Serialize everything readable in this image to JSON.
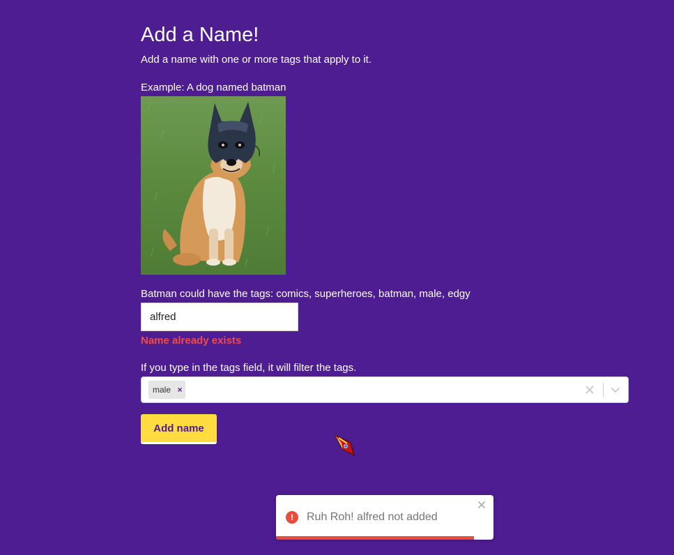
{
  "header": {
    "title": "Add a Name!",
    "subtitle": "Add a name with one or more tags that apply to it."
  },
  "example": {
    "label": "Example: A dog named batman",
    "tags_hint": "Batman could have the tags: comics, superheroes, batman, male, edgy"
  },
  "name_field": {
    "value": "alfred",
    "error": "Name already exists"
  },
  "tags_field": {
    "hint": "If you type in the tags field, it will filter the tags.",
    "selected": [
      "male"
    ],
    "remove_glyph": "×"
  },
  "submit": {
    "label": "Add name"
  },
  "toast": {
    "icon": "!",
    "message": "Ruh Roh! alfred not added",
    "progress_fraction": 0.91
  },
  "colors": {
    "background": "#4e1d91",
    "button": "#ffdc3f",
    "error": "#f04a4a",
    "toast_accent": "#e74c3c"
  }
}
